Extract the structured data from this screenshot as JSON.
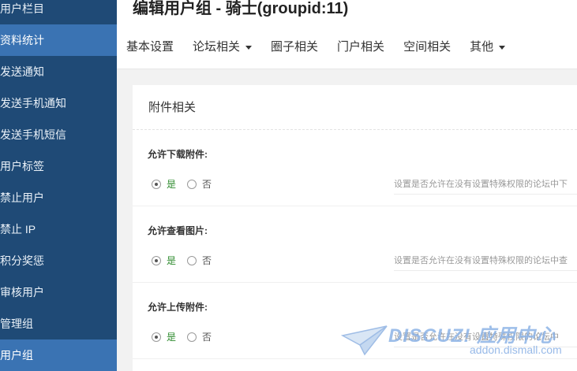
{
  "sidebar": {
    "items": [
      {
        "label": "用户栏目",
        "active": false
      },
      {
        "label": "资料统计",
        "active": true
      },
      {
        "label": "发送通知",
        "active": false
      },
      {
        "label": "发送手机通知",
        "active": false
      },
      {
        "label": "发送手机短信",
        "active": false
      },
      {
        "label": "用户标签",
        "active": false
      },
      {
        "label": "禁止用户",
        "active": false
      },
      {
        "label": "禁止 IP",
        "active": false
      },
      {
        "label": "积分奖惩",
        "active": false
      },
      {
        "label": "审核用户",
        "active": false
      },
      {
        "label": "管理组",
        "active": false
      },
      {
        "label": "用户组",
        "active": true
      }
    ]
  },
  "header": {
    "title": "编辑用户组 - 骑士(groupid:11)",
    "tabs": [
      {
        "label": "基本设置",
        "dropdown": false
      },
      {
        "label": "论坛相关",
        "dropdown": true
      },
      {
        "label": "圈子相关",
        "dropdown": false
      },
      {
        "label": "门户相关",
        "dropdown": false
      },
      {
        "label": "空间相关",
        "dropdown": false
      },
      {
        "label": "其他",
        "dropdown": true
      }
    ]
  },
  "panel": {
    "title": "附件相关",
    "settings": [
      {
        "label": "允许下载附件:",
        "yes": "是",
        "no": "否",
        "selected": "yes",
        "description": "设置是否允许在没有设置特殊权限的论坛中下"
      },
      {
        "label": "允许查看图片:",
        "yes": "是",
        "no": "否",
        "selected": "yes",
        "description": "设置是否允许在没有设置特殊权限的论坛中查"
      },
      {
        "label": "允许上传附件:",
        "yes": "是",
        "no": "否",
        "selected": "yes",
        "description": "设置是否允许在没有设置特殊权限的论坛中"
      }
    ]
  },
  "watermark": {
    "brand": "DISCUZ! 应用中心",
    "url": "addon.dismall.com"
  },
  "colors": {
    "sidebar_bg": "#1f4a76",
    "sidebar_active": "#3a73b3",
    "yes_label": "#2e8b2e"
  }
}
